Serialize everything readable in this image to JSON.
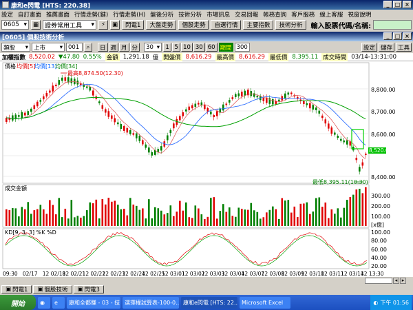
{
  "window": {
    "title": "康和e閃電  [HTS: 220.38]"
  },
  "menu": [
    "設定",
    "自訂畫面",
    "推薦畫面",
    "行情走勢(鍵)",
    "行情走勢(H)",
    "盤後分析",
    "技術分析",
    "市場訊息",
    "交易回報",
    "帳務查詢",
    "客戶服務",
    "線上客服",
    "視窗說明"
  ],
  "toolbar": {
    "code": "0605",
    "tool_select": "證券常用工具",
    "buttons": [
      "閃電1",
      "大盤走勢",
      "個股走勢",
      "自選行情",
      "主要指數",
      "技術分析"
    ],
    "input_label": "輸入股票代碼/名稱:"
  },
  "subwindow": {
    "title": "[0605] 個股技術分析"
  },
  "chartbar": {
    "kind": "類股",
    "market": "上市",
    "index_code": "001",
    "period_buttons": [
      "日",
      "週",
      "月",
      "分"
    ],
    "minute_value": "30",
    "count_buttons": [
      "1",
      "5",
      "10",
      "30",
      "60"
    ],
    "days_label": "期間",
    "days_value": "300",
    "right_buttons": [
      "設定",
      "儲存",
      "工具"
    ]
  },
  "quote": {
    "name": "加權指數",
    "price": "8,520.02",
    "change": "▼47.80",
    "change_pct": "0.55%",
    "amount_label": "金額",
    "amount": "1,291.18",
    "amount_unit": "億",
    "open_label": "開盤價",
    "open": "8,616.29",
    "high_label": "最高價",
    "high": "8,616.29",
    "low_label": "最低價",
    "low": "8,395.11",
    "time_label": "成交時間",
    "time": "03/14-13:31:00"
  },
  "price_panel": {
    "legend": [
      "價格",
      "均價[5]",
      "均價[13]",
      "均價[34]"
    ],
    "high_note": "最高8,874.50(12.30)",
    "low_note": "最低8,395.11(10.30)",
    "right_labels": [
      "8,800.00",
      "8,700.00",
      "8,600.00",
      "8,520.02",
      "8,400.00"
    ],
    "current_box": "8,520.02"
  },
  "volume_panel": {
    "title": "成交金額",
    "right_labels": [
      "300.00",
      "200.00",
      "100.00",
      "[x億]"
    ]
  },
  "kd_panel": {
    "legend": "KD[9, 3, 3]  %K  %D",
    "right_labels": [
      "100.00",
      "80.00",
      "60.00",
      "40.00",
      "20.00"
    ]
  },
  "xaxis": {
    "labels": [
      "09:30",
      "02/17",
      "12 02/18",
      "12 02/21",
      "12 02/22",
      "12 02/23",
      "12 02/24",
      "12 02/25",
      "12 03/01",
      "12 03/02",
      "12 03/03",
      "12 03/04",
      "12 03/07",
      "12 03/08",
      "12 03/09",
      "12 03/10",
      "12 03/11",
      "12 03/14",
      "12 13:30"
    ]
  },
  "mini_tabs": [
    "閃電1",
    "個股技術",
    "閃電3"
  ],
  "taskbar": {
    "start": "開始",
    "tasks": [
      "康和全都賺 - 03 - 技...",
      "選擇權試算表-100-0...",
      "康和e閃電 [HTS: 22...",
      "Microsoft Excel"
    ],
    "clock": "下午 01:56"
  },
  "chart_data": {
    "type": "candlestick",
    "ylim": [
      8300,
      8900
    ],
    "series_names": [
      "價格",
      "均價[5]",
      "均價[13]",
      "均價[34]",
      "成交金額",
      "%K",
      "%D"
    ]
  }
}
